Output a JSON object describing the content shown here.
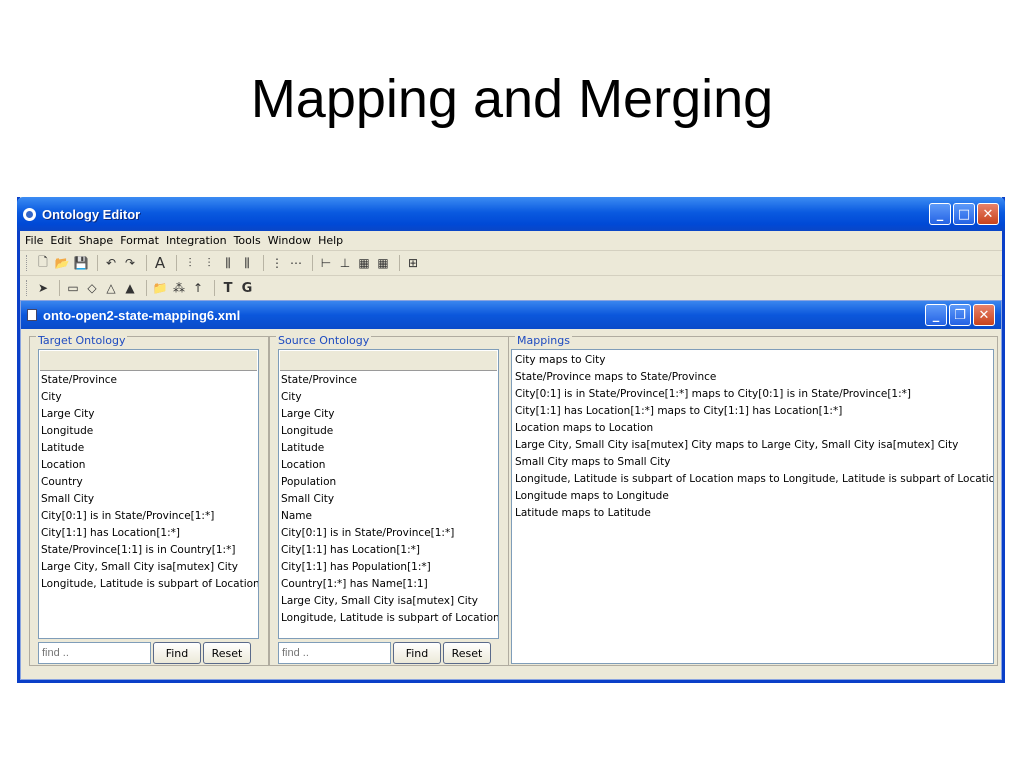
{
  "slide": {
    "title": "Mapping and Merging"
  },
  "window": {
    "title": "Ontology Editor"
  },
  "menu": [
    "File",
    "Edit",
    "Shape",
    "Format",
    "Integration",
    "Tools",
    "Window",
    "Help"
  ],
  "toolbar2_text": {
    "text_tool": "T",
    "group_tool": "G"
  },
  "document": {
    "title": "onto-open2-state-mapping6.xml"
  },
  "target": {
    "label": "Target Ontology",
    "items": [
      "State/Province",
      "City",
      "Large City",
      "Longitude",
      "Latitude",
      "Location",
      "Country",
      "Small City",
      "City[0:1] is in State/Province[1:*]",
      "City[1:1] has Location[1:*]",
      "State/Province[1:1] is in Country[1:*]",
      "Large City, Small City isa[mutex] City",
      "Longitude, Latitude is subpart of Location"
    ],
    "find_placeholder": "find ..",
    "find_label": "Find",
    "reset_label": "Reset"
  },
  "source": {
    "label": "Source Ontology",
    "items": [
      "State/Province",
      "City",
      "Large City",
      "Longitude",
      "Latitude",
      "Location",
      "Population",
      "Small City",
      "Name",
      "City[0:1] is in State/Province[1:*]",
      "City[1:1] has Location[1:*]",
      "City[1:1] has Population[1:*]",
      "Country[1:*] has Name[1:1]",
      "Large City, Small City isa[mutex] City",
      "Longitude, Latitude is subpart of Location"
    ],
    "find_placeholder": "find ..",
    "find_label": "Find",
    "reset_label": "Reset"
  },
  "mappings": {
    "label": "Mappings",
    "items": [
      "City maps to City",
      "State/Province maps to State/Province",
      "City[0:1] is in State/Province[1:*] maps to City[0:1] is in State/Province[1:*]",
      "City[1:1] has Location[1:*] maps to City[1:1] has Location[1:*]",
      "Location maps to Location",
      "Large City, Small City isa[mutex] City  maps to Large City, Small City isa[mutex] City",
      "Small City maps to Small City",
      "Longitude, Latitude is subpart of Location maps to Longitude, Latitude is subpart of Location",
      "Longitude maps to Longitude",
      "Latitude maps to Latitude"
    ]
  },
  "colors": {
    "titlebar": "#0a5ae0",
    "panel_label": "#1e4bc0",
    "window_bg": "#ece9d8"
  }
}
